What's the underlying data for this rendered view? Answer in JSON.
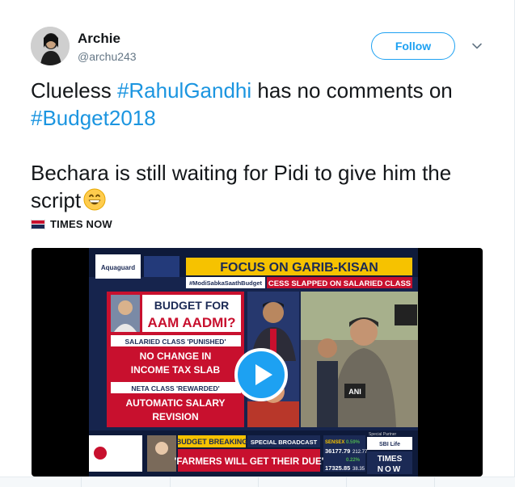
{
  "tweet": {
    "author": {
      "name": "Archie",
      "handle": "@archu243"
    },
    "follow_label": "Follow",
    "text": {
      "line1_prefix": "Clueless ",
      "line1_hashtag": "#RahulGandhi",
      "line1_suffix": " has no comments on",
      "line2_hashtag": "#Budget2018",
      "line3": "Bechara is still waiting for Pidi to give him the",
      "line4": "script"
    },
    "source": {
      "name": "TIMES NOW"
    }
  },
  "video": {
    "banner_title": "FOCUS ON GARIB-KISAN",
    "hashtag_tag": "#ModiSabkaSaathBudget",
    "cess_headline": "CESS SLAPPED ON SALARIED CLASS",
    "sponsor": "Aquaguard",
    "budget_for": "BUDGET FOR",
    "aam_aadmi": "AAM AADMI?",
    "salaried_tag": "SALARIED CLASS 'PUNISHED'",
    "no_change_line1": "NO CHANGE IN",
    "no_change_line2": "INCOME TAX SLAB",
    "neta_tag": "NETA CLASS 'REWARDED'",
    "salary_line1": "AUTOMATIC SALARY",
    "salary_line2": "REVISION",
    "breaking_label": "BUDGET BREAKING",
    "special_broadcast": "SPECIAL BROADCAST",
    "farmers_quote": "'FARMERS WILL GET THEIR DUE'",
    "sensex_label": "SENSEX",
    "sensex_change": "0.59%",
    "sensex_value": "36177.79",
    "sensex_delta": "212.77",
    "nifty_change": "0.22%",
    "nifty_value": "17325.85",
    "nifty_delta": "38.35",
    "channel_top": "TIMES",
    "channel_bottom": "NOW",
    "ani_logo": "ANI",
    "sbi_label": "SBI Life",
    "special_partner": "Special Partner",
    "play_icon": "play-circle-icon"
  },
  "colors": {
    "hashtag": "#1b95e0",
    "follow": "#1da1f2",
    "text": "#14171a",
    "muted": "#657786",
    "news_red": "#c8102e",
    "news_yellow": "#f6c200",
    "news_blue": "#1b2a55"
  }
}
